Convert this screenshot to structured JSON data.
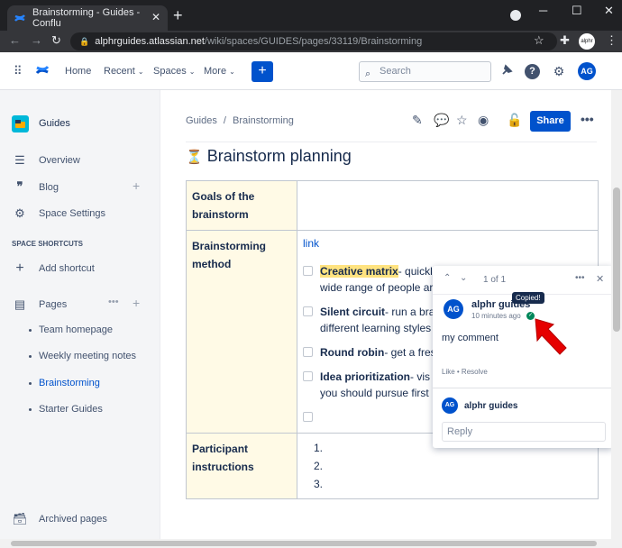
{
  "browser": {
    "tab_title": "Brainstorming - Guides - Conflu",
    "tab_close": "✕",
    "new_tab": "+",
    "url_domain": "alphrguides.atlassian.net",
    "url_path": "/wiki/spaces/GUIDES/pages/33119/Brainstorming",
    "profile_label": "alphr"
  },
  "header": {
    "nav": [
      "Home",
      "Recent",
      "Spaces",
      "More"
    ],
    "create_label": "+",
    "search_placeholder": "Search",
    "avatar_initials": "AG"
  },
  "sidebar": {
    "space_name": "Guides",
    "items": [
      {
        "label": "Overview",
        "icon": "overview-icon"
      },
      {
        "label": "Blog",
        "icon": "quote-icon"
      },
      {
        "label": "Space Settings",
        "icon": "gear-icon"
      }
    ],
    "shortcuts_heading": "SPACE SHORTCUTS",
    "add_shortcut": "Add shortcut",
    "pages_label": "Pages",
    "pages": [
      {
        "label": "Team homepage"
      },
      {
        "label": "Weekly meeting notes"
      },
      {
        "label": "Brainstorming",
        "active": true
      },
      {
        "label": "Starter Guides"
      }
    ],
    "archived": "Archived pages"
  },
  "page": {
    "breadcrumb": [
      "Guides",
      "Brainstorming"
    ],
    "breadcrumb_sep": "/",
    "share_label": "Share",
    "title_icon": "⏳",
    "title": "Brainstorm planning",
    "table": {
      "row1_header": "Goals of the brainstorm",
      "row2_header": "Brainstorming method",
      "row2_link": "link",
      "tasks": [
        {
          "bold": "Creative matrix",
          "text": "- quickl",
          "text2": "wide range of people ar",
          "highlight": true
        },
        {
          "bold": "Silent circuit",
          "text": "- run a bra",
          "text2": "different learning styles",
          "highlight": false
        },
        {
          "bold": "Round robin",
          "text": "- get a fres",
          "text2": "",
          "highlight": false
        },
        {
          "bold": "Idea prioritization",
          "text": "- vis",
          "text2": "you should pursue first",
          "highlight": false
        }
      ],
      "row3_header": "Participant instructions",
      "row3_items": [
        "1.",
        "2.",
        "3."
      ]
    }
  },
  "comment": {
    "counter": "1 of 1",
    "author": "alphr guides",
    "time": "10 minutes ago",
    "tooltip": "Copied!",
    "body": "my comment",
    "actions": "Like • Resolve",
    "reply_author": "alphr guides",
    "reply_placeholder": "Reply",
    "avatar_initials": "AG"
  },
  "colors": {
    "brand": "#0052cc",
    "table_header_bg": "#fffae6",
    "highlight": "#ffe380",
    "arrow": "#e60000"
  }
}
